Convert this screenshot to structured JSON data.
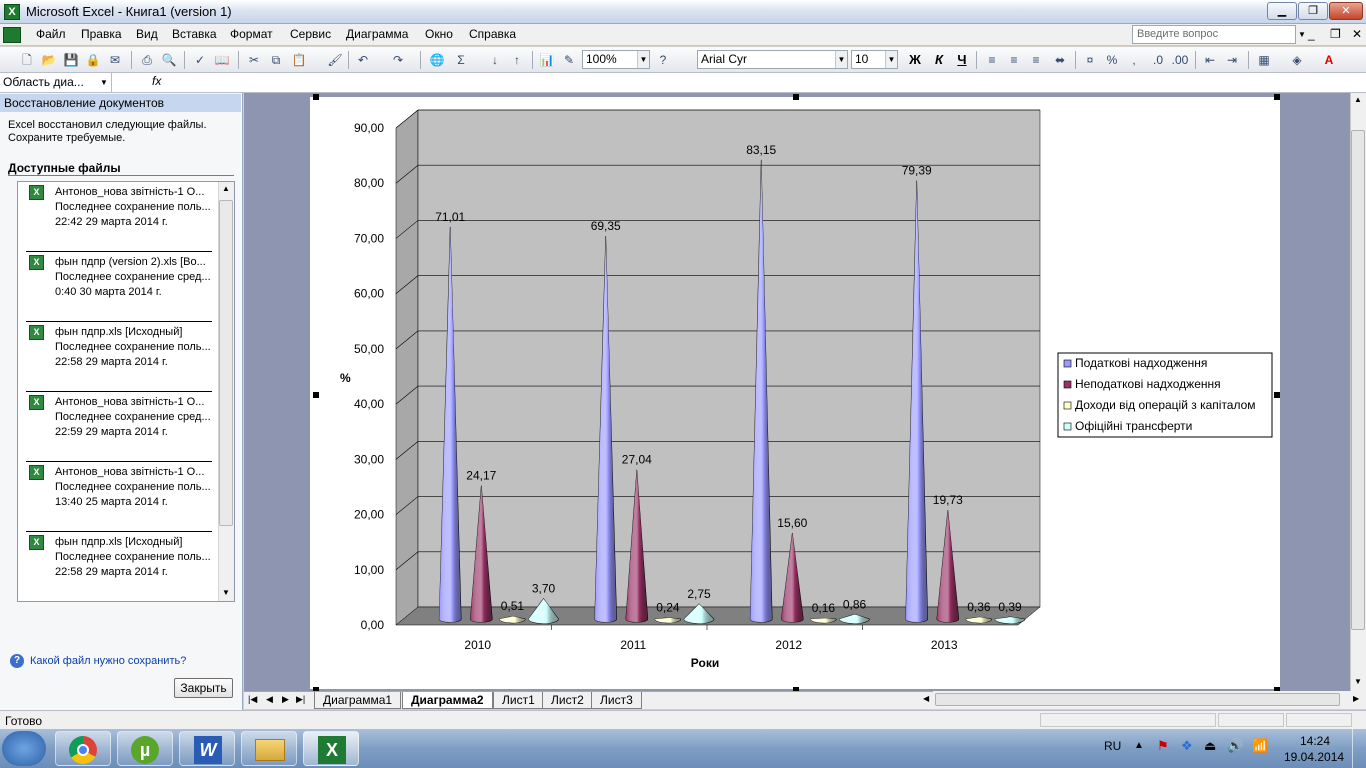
{
  "window": {
    "title": "Microsoft Excel - Книга1 (version 1)"
  },
  "menu": [
    "Файл",
    "Правка",
    "Вид",
    "Вставка",
    "Формат",
    "Сервис",
    "Диаграмма",
    "Окно",
    "Справка"
  ],
  "ask_placeholder": "Введите вопрос",
  "toolbar": {
    "zoom": "100%",
    "font": "Arial Cyr",
    "font_size": "10",
    "bold": "Ж",
    "italic": "К",
    "underline": "Ч"
  },
  "formula": {
    "name_box": "Область диа...",
    "fx": "fx"
  },
  "task_pane": {
    "title": "Восстановление документов",
    "message": "Excel восстановил следующие файлы. Сохраните требуемые.",
    "available": "Доступные файлы",
    "files": [
      {
        "name": "Антонов_нова звітність-1 О...",
        "desc": "Последнее сохранение поль...",
        "date": "22:42 29 марта 2014 г."
      },
      {
        "name": "фын пдпр (version 2).xls  [Во...",
        "desc": "Последнее сохранение сред...",
        "date": "0:40 30 марта 2014 г."
      },
      {
        "name": "фын пдпр.xls  [Исходный]",
        "desc": "Последнее сохранение поль...",
        "date": "22:58 29 марта 2014 г."
      },
      {
        "name": "Антонов_нова звітність-1 О...",
        "desc": "Последнее сохранение сред...",
        "date": "22:59 29 марта 2014 г."
      },
      {
        "name": "Антонов_нова звітність-1 О...",
        "desc": "Последнее сохранение поль...",
        "date": "13:40 25 марта 2014 г."
      },
      {
        "name": "фын пдпр.xls  [Исходный]",
        "desc": "Последнее сохранение поль...",
        "date": "22:58 29 марта 2014 г."
      }
    ],
    "help": "Какой файл нужно сохранить?",
    "close": "Закрыть"
  },
  "sheet_tabs": [
    "Диаграмма1",
    "Диаграмма2",
    "Лист1",
    "Лист2",
    "Лист3"
  ],
  "active_tab": "Диаграмма2",
  "status": "Готово",
  "tray": {
    "lang": "RU",
    "time": "14:24",
    "date": "19.04.2014"
  },
  "chart_data": {
    "type": "bar",
    "style": "3d-cone",
    "categories": [
      "2010",
      "2011",
      "2012",
      "2013"
    ],
    "series": [
      {
        "name": "Податкові надходження",
        "values": [
          71.01,
          69.35,
          83.15,
          79.39
        ],
        "color": "#9999ff"
      },
      {
        "name": "Неподаткові надходження",
        "values": [
          24.17,
          27.04,
          15.6,
          19.73
        ],
        "color": "#993366"
      },
      {
        "name": "Доходи від операцій з капіталом",
        "values": [
          0.51,
          0.24,
          0.16,
          0.36
        ],
        "color": "#ffffcc"
      },
      {
        "name": "Офіційні трансферти",
        "values": [
          3.7,
          2.75,
          0.86,
          0.39
        ],
        "color": "#ccffff"
      }
    ],
    "data_labels": [
      [
        "71,01",
        "69,35",
        "83,15",
        "79,39"
      ],
      [
        "24,17",
        "27,04",
        "15,60",
        "19,73"
      ],
      [
        "0,51",
        "0,24",
        "0,16",
        "0,36"
      ],
      [
        "3,70",
        "2,75",
        "0,86",
        "0,39"
      ]
    ],
    "y_ticks": [
      "0,00",
      "10,00",
      "20,00",
      "30,00",
      "40,00",
      "50,00",
      "60,00",
      "70,00",
      "80,00",
      "90,00"
    ],
    "ylim": [
      0,
      90
    ],
    "xlabel": "Роки",
    "ylabel": "%",
    "grid": true,
    "legend": "right",
    "wall_color": "#c0c0c0",
    "floor_color": "#808080"
  }
}
